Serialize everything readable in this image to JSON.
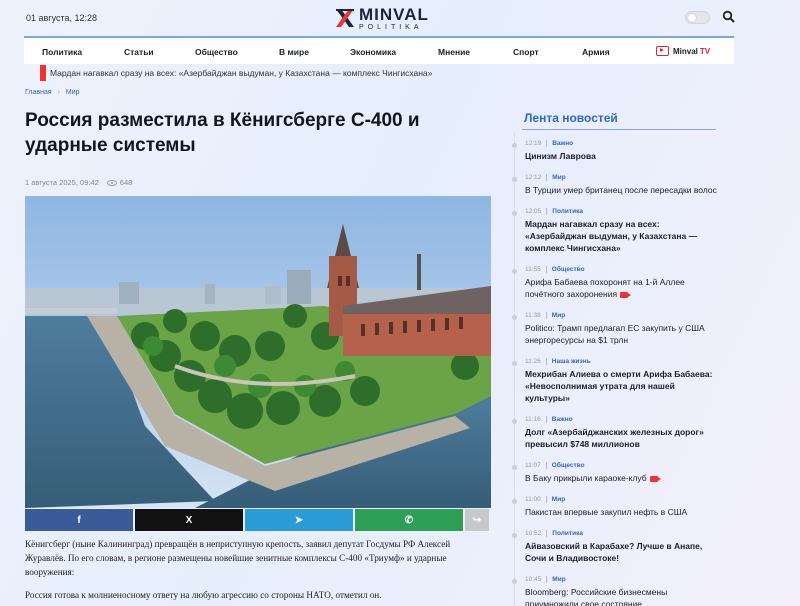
{
  "header": {
    "date": "01 августа, 12:28",
    "logo_name": "MINVAL",
    "logo_sub": "POLITIKA"
  },
  "nav": {
    "items": [
      "Политика",
      "Статьи",
      "Общество",
      "В мире",
      "Экономика",
      "Мнение",
      "Спорт",
      "Армия"
    ],
    "tv_label": "Minval",
    "tv_suffix": "TV"
  },
  "ticker": {
    "text": "Мардан нагавкал сразу на всех: «Азербайджан выдуман, у Казахстана — комплекс Чингисхана»"
  },
  "breadcrumb": [
    "Главная",
    "Мир"
  ],
  "article": {
    "title": "Россия разместила в Кёнигсберге С-400 и ударные системы",
    "date": "1 августа 2025, 09:42",
    "views": "648",
    "paragraph1": "Кёнигсберг (ныне Калининград) превращён в неприступную крепость, заявил депутат Госдумы РФ Алексей Журавлёв. По его словам, в регионе размещены новейшие зенитные комплексы С-400 «Триумф» и ударные вооружения:",
    "paragraph2": "Россия готова к молниеносному ответу на любую агрессию со стороны НАТО, отметил он."
  },
  "share": {
    "fb": "f",
    "x": "X",
    "tg": "➤",
    "wa": "✆",
    "more": "↪"
  },
  "feed": {
    "title": "Лента новостей",
    "items": [
      {
        "time": "12:19",
        "cat": "Важно",
        "headline": "Цинизм Лаврова",
        "bold": true,
        "video": false
      },
      {
        "time": "12:12",
        "cat": "Мир",
        "headline": "В Турции умер британец после пересадки волос",
        "bold": false,
        "video": false
      },
      {
        "time": "12:05",
        "cat": "Политика",
        "headline": "Мардан нагавкал сразу на всех: «Азербайджан выдуман, у Казахстана — комплекс Чингисхана»",
        "bold": true,
        "video": false
      },
      {
        "time": "11:55",
        "cat": "Общество",
        "headline": "Арифа Бабаева похоронят на 1-й Аллее почётного захоронения",
        "bold": false,
        "video": true
      },
      {
        "time": "11:38",
        "cat": "Мир",
        "headline": "Politico: Трамп предлагал ЕС закупить у США энергоресурсы на $1 трлн",
        "bold": false,
        "video": false
      },
      {
        "time": "11:26",
        "cat": "Наша жизнь",
        "headline": "Мехрибан Алиева о смерти Арифа Бабаева: «Невосполнимая утрата для нашей культуры»",
        "bold": true,
        "video": false
      },
      {
        "time": "11:16",
        "cat": "Важно",
        "headline": "Долг «Азербайджанских железных дорог» превысил $748 миллионов",
        "bold": true,
        "video": false
      },
      {
        "time": "11:07",
        "cat": "Общество",
        "headline": "В Баку прикрыли караоке-клуб",
        "bold": false,
        "video": true
      },
      {
        "time": "11:00",
        "cat": "Мир",
        "headline": "Пакистан впервые закупил нефть в США",
        "bold": false,
        "video": false
      },
      {
        "time": "10:52",
        "cat": "Политика",
        "headline": "Айвазовский в Карабахе? Лучше в Анапе, Сочи и Владивостоке!",
        "bold": true,
        "video": false
      },
      {
        "time": "10:45",
        "cat": "Мир",
        "headline": "Bloomberg: Российские бизнесмены приумножили свое состояние",
        "bold": false,
        "video": false
      }
    ]
  }
}
